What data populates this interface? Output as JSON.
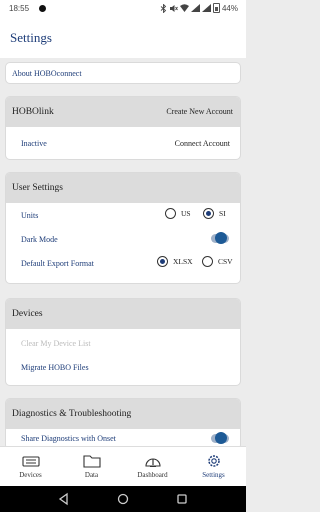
{
  "status": {
    "time": "18:55",
    "battery": "44%"
  },
  "header": {
    "title": "Settings"
  },
  "about": {
    "label": "About HOBOconnect"
  },
  "hobolink": {
    "title": "HOBOlink",
    "action": "Create New Account",
    "status": "Inactive",
    "connect": "Connect Account"
  },
  "user_settings": {
    "title": "User Settings",
    "units_label": "Units",
    "units_options": [
      "US",
      "SI"
    ],
    "units_selected": "SI",
    "dark_mode_label": "Dark Mode",
    "dark_mode_on": true,
    "export_label": "Default Export Format",
    "export_options": [
      "XLSX",
      "CSV"
    ],
    "export_selected": "XLSX"
  },
  "devices": {
    "title": "Devices",
    "clear": "Clear My Device List",
    "migrate": "Migrate HOBO Files"
  },
  "diagnostics": {
    "title": "Diagnostics & Troubleshooting",
    "share": "Share Diagnostics with Onset",
    "share_on": true
  },
  "nav": [
    {
      "label": "Devices",
      "icon": "devices-icon"
    },
    {
      "label": "Data",
      "icon": "folder-icon"
    },
    {
      "label": "Dashboard",
      "icon": "dashboard-icon"
    },
    {
      "label": "Settings",
      "icon": "gear-icon"
    }
  ],
  "colors": {
    "accent": "#1d3c78",
    "toggle": "#1d5a96",
    "section_header": "#dcdcdc"
  }
}
